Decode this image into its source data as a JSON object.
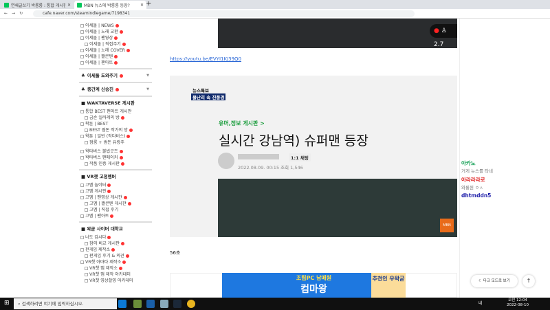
{
  "browser": {
    "tabs": [
      {
        "title": "연쇄글쓰기 박룡룡 : 통합 게시판"
      },
      {
        "title": "MBN 뉴스에 박룡룡 등장?"
      }
    ],
    "url": "cafe.naver.com/steamindiegame/7198341"
  },
  "sidebar": {
    "group1": [
      "이세돌 | NEWS",
      "이세돌 | 노래 교환",
      "이세돌 | 팬영상",
      "이세돌 | 직접주기",
      "이세돌 | 노래 COVER",
      "이세돌 | 짤콘텐",
      "이세돌 | 팬아트"
    ],
    "sec1": "이세돌 도와주기",
    "sec2": "중간계 신승진",
    "h1": "■ WAKTAVERSE 게시판",
    "group2": [
      "통합 BEST 팬아트 게시판",
      "금손 일러레의 방",
      "왁툰 | BEST",
      "BEST 썸돈 작가의 방",
      "왁툰 | 일반 (작타버스)",
      "점룸 + 썸돈 유랑주"
    ],
    "group3": [
      "왁타버스 불법굿즈",
      "왁타버스 팬메이커",
      "작품 인증 게시판"
    ],
    "h2": "■ VR챗 고정멤버",
    "group4": [
      "고멤 놀이터",
      "고멤 게시판",
      "고멤 | 팬영상 게시판",
      "고멤 | 짤콘텐 게시판",
      "고멤 | 직접 후기",
      "고멤 | 팬아트"
    ],
    "h3": "■ 왁굳 사이버 대학교",
    "group5": [
      "너도 감시다",
      "참의 비교 게시판",
      "펀게임 제작소",
      "펀게임 후기 & 의견",
      "VR챗 아바타 제작소",
      "VR챗 맵 제작소",
      "VR챗 맵 제작 아카데미",
      "VR챗 영상촬영 아카데미"
    ]
  },
  "article": {
    "viewers": "2.7",
    "link": "https://youtu.be/EVYI1KJ39Q0",
    "caption_top": "뉴스특보",
    "caption_bottom": "물난리 속 진풍경",
    "board": "유머,정보 게시판 >",
    "title": "실시간 강남역) 슈퍼맨 등장",
    "chat_button": "1:1 채팅",
    "meta": "2022.08.09. 00:15  조회 1,546",
    "mbn": "MBN NEWS",
    "duration": "56초"
  },
  "ad": {
    "line1": "조립PC 남매원",
    "line2": "컴마왕",
    "badge": "추천인 우왁굳"
  },
  "chat": [
    {
      "name": "아카노",
      "msg": "거게 뉴스를 타네",
      "color": "#13a055"
    },
    {
      "name": "아라라라로",
      "msg": "와룡원 ㅇㅅ",
      "color": "#e02020"
    },
    {
      "name": "dhtmddn5",
      "msg": "",
      "color": "#1a1aa8"
    }
  ],
  "buttons": {
    "dark_mode": "다크 모드로 보기",
    "top": "↑"
  },
  "taskbar": {
    "search": "검색하려면 여기에 입력하십시오.",
    "time": "오전 12:04",
    "date": "2022-08-10",
    "lang": "네"
  }
}
